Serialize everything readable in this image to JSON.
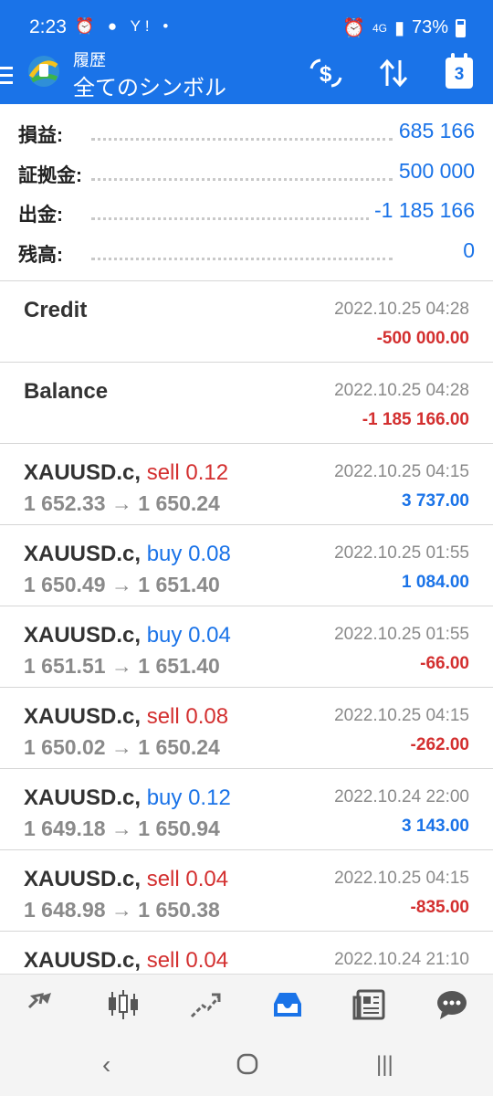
{
  "status": {
    "time": "2:23",
    "left_icons": "⏰ ● Y! •",
    "network": "4G",
    "battery": "73%"
  },
  "appbar": {
    "subtitle": "履歴",
    "title": "全てのシンボル",
    "calendar_day": "3"
  },
  "summary": [
    {
      "label": "損益:",
      "value": "685 166"
    },
    {
      "label": "証拠金:",
      "value": "500 000"
    },
    {
      "label": "出金:",
      "value": "-1 185 166"
    },
    {
      "label": "残高:",
      "value": "0"
    }
  ],
  "deals": [
    {
      "symbol": "Credit",
      "side": "",
      "volume": "",
      "time": "2022.10.25 04:28",
      "prices": "",
      "profit": "-500 000.00",
      "sign": "neg"
    },
    {
      "symbol": "Balance",
      "side": "",
      "volume": "",
      "time": "2022.10.25 04:28",
      "prices": "",
      "profit": "-1 185 166.00",
      "sign": "neg"
    },
    {
      "symbol": "XAUUSD.c,",
      "side": "sell",
      "volume": "0.12",
      "time": "2022.10.25 04:15",
      "prices": "1 652.33 → 1 650.24",
      "profit": "3 737.00",
      "sign": "pos"
    },
    {
      "symbol": "XAUUSD.c,",
      "side": "buy",
      "volume": "0.08",
      "time": "2022.10.25 01:55",
      "prices": "1 650.49 → 1 651.40",
      "profit": "1 084.00",
      "sign": "pos"
    },
    {
      "symbol": "XAUUSD.c,",
      "side": "buy",
      "volume": "0.04",
      "time": "2022.10.25 01:55",
      "prices": "1 651.51 → 1 651.40",
      "profit": "-66.00",
      "sign": "neg"
    },
    {
      "symbol": "XAUUSD.c,",
      "side": "sell",
      "volume": "0.08",
      "time": "2022.10.25 04:15",
      "prices": "1 650.02 → 1 650.24",
      "profit": "-262.00",
      "sign": "neg"
    },
    {
      "symbol": "XAUUSD.c,",
      "side": "buy",
      "volume": "0.12",
      "time": "2022.10.24 22:00",
      "prices": "1 649.18 → 1 650.94",
      "profit": "3 143.00",
      "sign": "pos"
    },
    {
      "symbol": "XAUUSD.c,",
      "side": "sell",
      "volume": "0.04",
      "time": "2022.10.25 04:15",
      "prices": "1 648.98 → 1 650.38",
      "profit": "-835.00",
      "sign": "neg"
    },
    {
      "symbol": "XAUUSD.c,",
      "side": "sell",
      "volume": "0.04",
      "time": "2022.10.24 21:10",
      "prices": "",
      "profit": "",
      "sign": "neg"
    }
  ],
  "bottom_nav": [
    {
      "icon": "quotes-icon",
      "active": false
    },
    {
      "icon": "chart-icon",
      "active": false
    },
    {
      "icon": "trade-icon",
      "active": false
    },
    {
      "icon": "history-icon",
      "active": true
    },
    {
      "icon": "news-icon",
      "active": false
    },
    {
      "icon": "chat-icon",
      "active": false
    }
  ],
  "colors": {
    "accent": "#1a73e8",
    "negative": "#d32f2f",
    "muted": "#8a8a8a"
  }
}
